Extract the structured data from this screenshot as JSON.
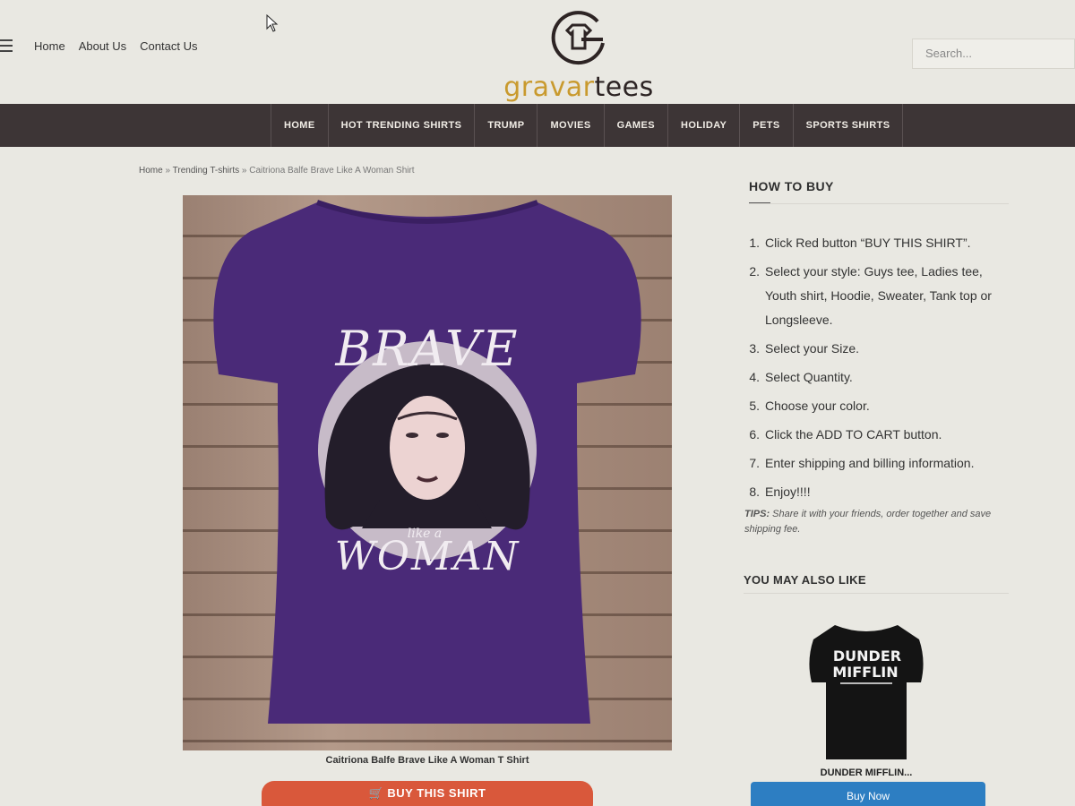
{
  "header": {
    "top_links": [
      "Home",
      "About Us",
      "Contact Us"
    ],
    "logo_text_part1": "gravar",
    "logo_text_part2": "tees",
    "search_placeholder": "Search..."
  },
  "nav": {
    "items": [
      "HOME",
      "HOT TRENDING SHIRTS",
      "TRUMP",
      "MOVIES",
      "GAMES",
      "HOLIDAY",
      "PETS",
      "SPORTS SHIRTS"
    ]
  },
  "breadcrumb": {
    "home": "Home",
    "sep1": " » ",
    "category": "Trending T-shirts",
    "sep2": " » ",
    "current": "Caitriona Balfe Brave Like A Woman Shirt"
  },
  "product": {
    "shirt_text_top": "BRAVE",
    "shirt_text_mid": "like a",
    "shirt_text_bottom": "WOMAN",
    "caption": "Caitriona Balfe Brave Like A Woman T Shirt",
    "buy_button": "BUY THIS SHIRT"
  },
  "sidebar": {
    "how_to_buy_title": "HOW TO BUY",
    "steps": [
      {
        "num": "1.",
        "text": "Click Red button “BUY THIS SHIRT”."
      },
      {
        "num": "2.",
        "text": "Select your style: Guys tee, Ladies tee, Youth shirt, Hoodie, Sweater, Tank top or Longsleeve."
      },
      {
        "num": "3.",
        "text": "Select your Size."
      },
      {
        "num": "4.",
        "text": "Select Quantity."
      },
      {
        "num": "5.",
        "text": "Choose your color."
      },
      {
        "num": "6.",
        "text": "Click the ADD TO CART button."
      },
      {
        "num": "7.",
        "text": "Enter shipping and billing information."
      },
      {
        "num": "8.",
        "text": "Enjoy!!!!"
      }
    ],
    "tips_label": "TIPS:",
    "tips_text": " Share it with your friends, order together and save shipping fee.",
    "also_like_title": "YOU MAY ALSO LIKE",
    "related": {
      "shirt_line1": "DUNDER",
      "shirt_line2": "MIFFLIN",
      "name": "DUNDER MIFFLIN...",
      "button": "Buy Now"
    }
  },
  "colors": {
    "nav_bg": "#3d3536",
    "buy_button": "#d9583b",
    "shirt_purple": "#4a2a78",
    "logo_gold": "#c99a2e",
    "related_button": "#2d7ec2"
  }
}
